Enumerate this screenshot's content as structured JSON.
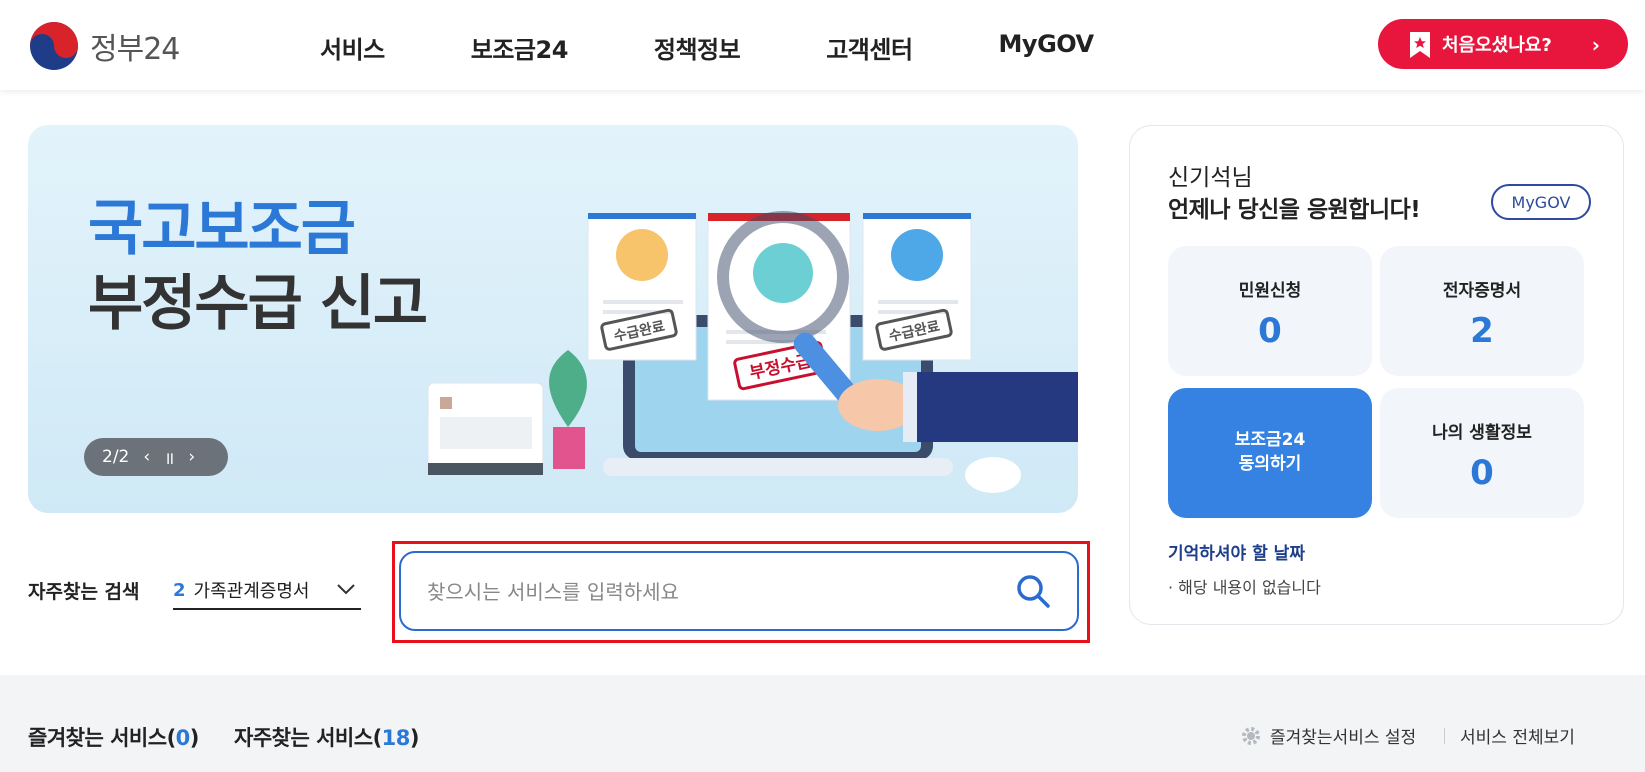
{
  "header": {
    "logo_text": "정부24",
    "nav": [
      "서비스",
      "보조금24",
      "정책정보",
      "고객센터",
      "MyGOV"
    ],
    "first_visit_label": "처음오셨나요?",
    "first_visit_chevron": "›"
  },
  "banner": {
    "title_line1": "국고보조금",
    "title_line2": "부정수급 신고",
    "stamp_left": "수급완료",
    "stamp_center": "부정수급",
    "stamp_right": "수급완료",
    "page_indicator": "2/2",
    "prev": "‹",
    "pause": "॥",
    "next": "›"
  },
  "search": {
    "frequent_label": "자주찾는 검색",
    "frequent_rank": "2",
    "frequent_term": "가족관계증명서",
    "placeholder": "찾으시는 서비스를 입력하세요",
    "value": ""
  },
  "side": {
    "greeting_name": "신기석님",
    "greeting_message": "언제나 당신을 응원합니다!",
    "mygov_button": "MyGOV",
    "tiles": [
      {
        "label": "민원신청",
        "value": "0"
      },
      {
        "label": "전자증명서",
        "value": "2"
      },
      {
        "label": "보조금24",
        "label2": "동의하기"
      },
      {
        "label": "나의 생활정보",
        "value": "0"
      }
    ],
    "dates_title": "기억하셔야 할 날짜",
    "dates_empty": "· 해당 내용이 없습니다"
  },
  "bottom": {
    "fav_label": "즐겨찾는 서비스",
    "fav_count": "0",
    "freq_label": "자주찾는 서비스",
    "freq_count": "18",
    "settings_label": "즐겨찾는서비스 설정",
    "all_label": "서비스 전체보기"
  },
  "colors": {
    "accent_blue": "#2b78d6",
    "brand_red": "#e8153d",
    "highlight_red": "#e8101b"
  }
}
